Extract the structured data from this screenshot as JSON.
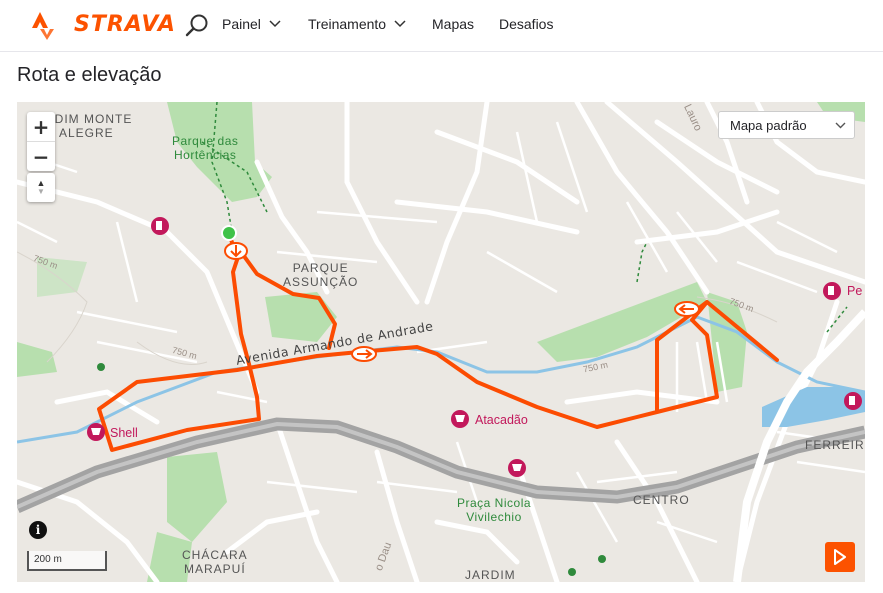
{
  "nav": {
    "brand": "STRAVA",
    "items": [
      {
        "label": "Painel",
        "has_dropdown": true
      },
      {
        "label": "Treinamento",
        "has_dropdown": true
      },
      {
        "label": "Mapas",
        "has_dropdown": false
      },
      {
        "label": "Desafios",
        "has_dropdown": false
      }
    ]
  },
  "page": {
    "title": "Rota e elevação"
  },
  "map": {
    "zoom_in": "+",
    "zoom_out": "−",
    "compass": "▲",
    "style_select": {
      "value": "Mapa padrão"
    },
    "info": "i",
    "scale": "200 m",
    "labels": {
      "jardim_monte_alegre": [
        "RDIM MONTE",
        "ALEGRE"
      ],
      "parque_hortencias": [
        "Parque das",
        "Hortências"
      ],
      "parque_assuncao": [
        "PARQUE",
        "ASSUNÇÃO"
      ],
      "chacara_marapui": [
        "CHÁCARA",
        "MARAPUÍ"
      ],
      "praca_nicola": [
        "Praça Nicola",
        "Vivilechio"
      ],
      "centro": "CENTRO",
      "ferreira": "FERREIR",
      "jardim": "JARDIM",
      "avenida": "Avenida Armando de Andrade",
      "lauro": "Lauro",
      "dau": "o Dau",
      "elev_750_a": "750 m",
      "elev_750_b": "750 m",
      "elev_750_c": "750 m",
      "elev_750_d": "750 m",
      "shell": "Shell",
      "atacadao": "Atacadão",
      "pe": "Pe"
    },
    "colors": {
      "route": "#fc4c02",
      "start": "#3fc248",
      "water": "#8cc4e6",
      "park": "#b7dfae",
      "highway": "#a3a3a3",
      "poi": "#c2185b"
    }
  }
}
